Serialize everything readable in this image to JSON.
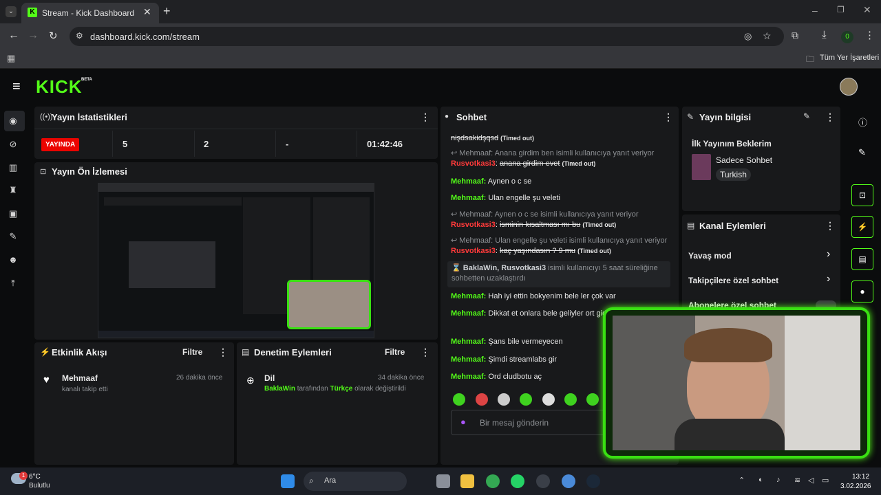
{
  "browser": {
    "tab_title": "Stream - Kick Dashboard",
    "url": "dashboard.kick.com/stream",
    "bookmarks_label": "Tüm Yer İşaretleri",
    "profile_badge": "0"
  },
  "kick": {
    "logo": "KICK",
    "beta": "BETA"
  },
  "stats": {
    "title": "Yayın İstatistikleri",
    "live_badge": "YAYINDA",
    "viewers": "5",
    "followers": "2",
    "dash": "-",
    "uptime": "01:42:46"
  },
  "preview": {
    "title": "Yayın Ön İzlemesi"
  },
  "activity": {
    "title": "Etkinlik Akışı",
    "filter": "Filtre",
    "item_user": "Mehmaaf",
    "item_text": "kanalı takip etti",
    "item_time": "26 dakika önce"
  },
  "moderation": {
    "title": "Denetim Eylemleri",
    "filter": "Filtre",
    "item_title": "Dil",
    "item_time": "34 dakika önce",
    "item_user": "BaklaWin",
    "item_mid": "tarafından",
    "item_value": "Türkçe",
    "item_tail": "olarak değiştirildi"
  },
  "chat": {
    "title": "Sohbet",
    "input_placeholder": "Bir mesaj gönderin",
    "top_cut": "nişdsakidşqsd",
    "timed_out": "(Timed out)",
    "reply1": "Mehmaaf: Anana girdim ben isimli kullanıcıya yanıt veriyor",
    "rus1_user": "Rusvotkasi3",
    "rus1_text": "anana girdim evet",
    "m1_user": "Mehmaaf:",
    "m1_text": "Aynen o c se",
    "m2_user": "Mehmaaf:",
    "m2_text": "Ulan engelle şu veleti",
    "reply2": "Mehmaaf: Aynen o c se isimli kullanıcıya yanıt veriyor",
    "rus2_user": "Rusvotkasi3",
    "rus2_text": "isminin kısaltması mı bu",
    "reply3": "Mehmaaf: Ulan engelle şu veleti isimli kullanıcıya yanıt veriyor",
    "rus3_user": "Rusvotkasi3",
    "rus3_text": "kaç yaşındasın ? 9 mu",
    "sys_users": "BaklaWin, Rusvotkasi3",
    "sys_text": "isimli kullanıcıyı 5 saat süreliğine sohbetten uzaklaştırdı",
    "m3_user": "Mehmaaf:",
    "m3_text": "Hah iyi ettin bokyenim bele ler çok var",
    "m4_user": "Mehmaaf:",
    "m4_text": "Dikkat et onlara bele geliyler ort gidiyler",
    "m5_user": "Mehmaaf:",
    "m5_text": "Şans bile vermeyecen",
    "m6_user": "Mehmaaf:",
    "m6_text": "Şimdi streamlabs gir",
    "m7_user": "Mehmaaf:",
    "m7_text": "Ord cludbotu aç"
  },
  "streaminfo": {
    "title": "Yayın bilgisi",
    "stream_title": "İlk Yayınım Beklerim",
    "category": "Sadece Sohbet",
    "language": "Turkish"
  },
  "channel_actions": {
    "title": "Kanal Eylemleri",
    "slow_mode": "Yavaş mod",
    "followers_only": "Takipçilere özel sohbet",
    "subs_only": "Abonelere özel sohbet"
  },
  "taskbar": {
    "weather_temp": "6°C",
    "weather_desc": "Bulutlu",
    "weather_badge": "1",
    "search": "Ara",
    "time": "13:12",
    "date": "3.02.2026"
  },
  "colors": {
    "accent": "#53fc18",
    "live": "#eb0400"
  }
}
